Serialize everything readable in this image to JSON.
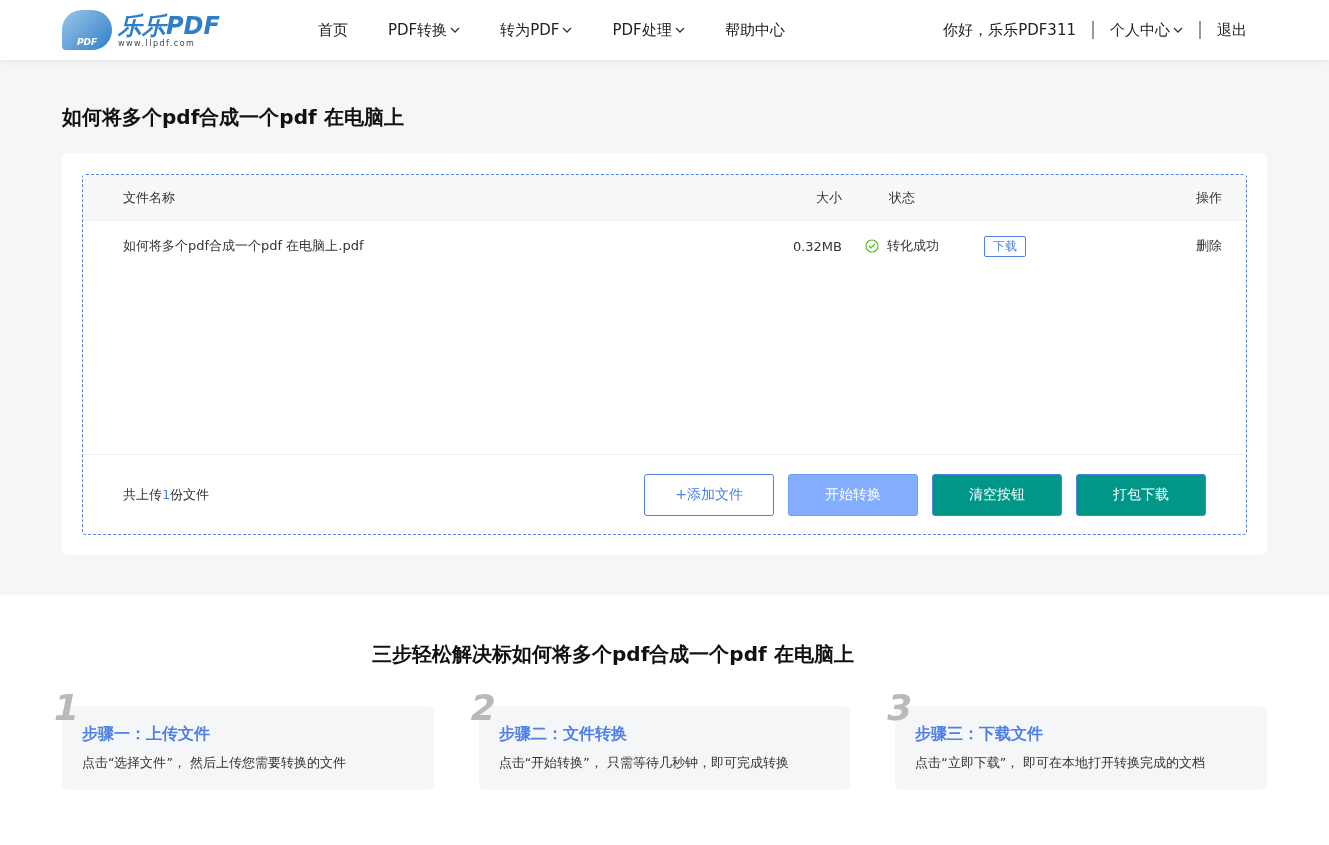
{
  "header": {
    "logo": {
      "badge": "PDF",
      "name": "乐乐PDF",
      "url": "www.llpdf.com"
    },
    "nav": [
      {
        "label": "首页",
        "has_dropdown": false
      },
      {
        "label": "PDF转换",
        "has_dropdown": true
      },
      {
        "label": "转为PDF",
        "has_dropdown": true
      },
      {
        "label": "PDF处理",
        "has_dropdown": true
      },
      {
        "label": "帮助中心",
        "has_dropdown": false
      }
    ],
    "greeting": "你好，乐乐PDF311",
    "user_menu": {
      "label": "个人中心",
      "has_dropdown": true
    },
    "logout": "退出"
  },
  "page_title": "如何将多个pdf合成一个pdf 在电脑上",
  "table": {
    "columns": [
      "文件名称",
      "大小",
      "状态",
      "操作"
    ],
    "rows": [
      {
        "name": "如何将多个pdf合成一个pdf 在电脑上.pdf",
        "size": "0.32MB",
        "status": "转化成功",
        "success": true,
        "download": "下载",
        "delete": "删除"
      }
    ]
  },
  "upload_summary": {
    "before": "共上传",
    "count": "1",
    "after": "份文件"
  },
  "buttons": [
    {
      "label": "+添加文件",
      "kind": "outline"
    },
    {
      "label": "开始转换",
      "kind": "light"
    },
    {
      "label": "清空按钮",
      "kind": "solid"
    },
    {
      "label": "打包下载",
      "kind": "solid"
    }
  ],
  "steps_title": "三步轻松解决标如何将多个pdf合成一个pdf 在电脑上",
  "steps": [
    {
      "number": "1",
      "title": "步骤一：上传文件",
      "text": "点击“选择文件”， 然后上传您需要转换的文件"
    },
    {
      "number": "2",
      "title": "步骤二：文件转换",
      "text": "点击“开始转换”， 只需等待几秒钟，即可完成转换"
    },
    {
      "number": "3",
      "title": "步骤三：下载文件",
      "text": "点击“立即下载”， 即可在本地打开转换完成的文档"
    }
  ]
}
